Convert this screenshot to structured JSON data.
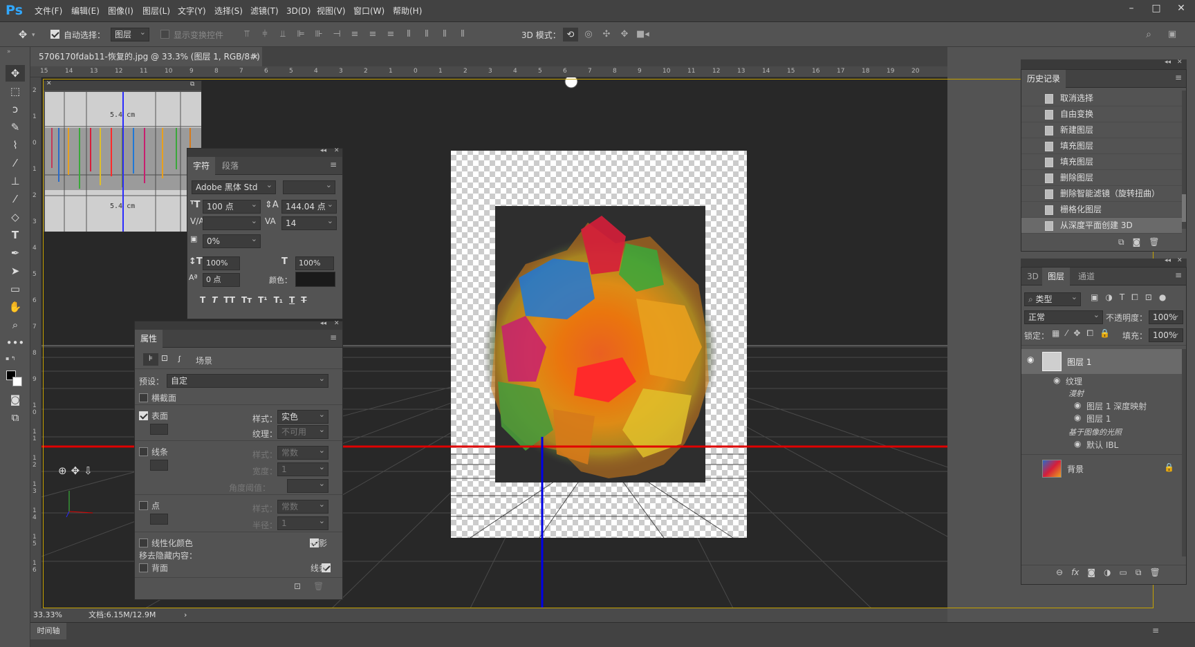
{
  "app": {
    "name": "Ps"
  },
  "menu": [
    "文件(F)",
    "编辑(E)",
    "图像(I)",
    "图层(L)",
    "文字(Y)",
    "选择(S)",
    "滤镜(T)",
    "3D(D)",
    "视图(V)",
    "窗口(W)",
    "帮助(H)"
  ],
  "window_controls": [
    "–",
    "□",
    "✕"
  ],
  "options": {
    "auto_select_label": "自动选择：",
    "auto_select_value": "图层",
    "show_transform_label": "显示变换控件",
    "mode3d_label": "3D 模式："
  },
  "document": {
    "tab_title": "5706170fdab11-恢复的.jpg @ 33.3% (图层 1, RGB/8#) *",
    "close": "×"
  },
  "ruler": {
    "top_ticks": [
      "15",
      "14",
      "13",
      "12",
      "11",
      "10",
      "9",
      "8",
      "7",
      "6",
      "5",
      "4",
      "3",
      "2",
      "1",
      "0",
      "1",
      "2",
      "3",
      "4",
      "5",
      "6",
      "7",
      "8",
      "9",
      "10",
      "11",
      "12",
      "13",
      "14",
      "15",
      "16",
      "17",
      "18",
      "19",
      "20"
    ],
    "left_ticks": [
      "2",
      "1",
      "0",
      "1",
      "2",
      "3",
      "4",
      "5",
      "6",
      "7",
      "8",
      "9",
      "1 0",
      "1 1",
      "1 2",
      "1 3",
      "1 4",
      "1 5",
      "1 6"
    ]
  },
  "texture_preview": {
    "measure1": "5.4  cm",
    "measure2": "5.4  cm"
  },
  "character_panel": {
    "tabs": [
      "字符",
      "段落"
    ],
    "font_family": "Adobe 黑体 Std",
    "font_size": "100 点",
    "leading": "144.04 点",
    "tracking": "14",
    "scale_pct": "0%",
    "vscale": "100%",
    "hscale": "100%",
    "baseline": "0 点",
    "color_label": "颜色："
  },
  "properties_panel": {
    "title": "属性",
    "scene_label": "场景",
    "preset_label": "预设：",
    "preset_value": "自定",
    "cross_section": "横截面",
    "surface": "表面",
    "style_label": "样式：",
    "surface_style": "实色",
    "texture_label": "纹理：",
    "texture_value": "不可用",
    "lines": "线条",
    "lines_style": "常数",
    "width_label": "宽度：",
    "width_value": "1",
    "angle_label": "角度阈值：",
    "points": "点",
    "points_style": "常数",
    "radius_label": "半径：",
    "radius_value": "1",
    "linearize": "线性化颜色",
    "shadow": "阴影",
    "remove_hidden": "移去隐藏内容：",
    "backface": "背面",
    "lines2": "线条"
  },
  "history_panel": {
    "title": "历史记录",
    "items": [
      "取消选择",
      "自由变换",
      "新建图层",
      "填充图层",
      "填充图层",
      "删除图层",
      "删除智能滤镜（旋转扭曲）",
      "栅格化图层",
      "从深度平面创建 3D"
    ]
  },
  "layers_panel": {
    "tabs": [
      "3D",
      "图层",
      "通道"
    ],
    "filter_kind": "类型",
    "blend_mode": "正常",
    "opacity_label": "不透明度：",
    "opacity": "100%",
    "lock_label": "锁定：",
    "fill_label": "填充：",
    "fill": "100%",
    "layers": {
      "layer1": "图层 1",
      "texture": "纹理",
      "diffuse": "漫射",
      "depth_map": "图层 1 深度映射",
      "layer1_sub": "图层 1",
      "ibl": "基于图像的光照",
      "default_ibl": "默认 IBL",
      "background": "背景"
    }
  },
  "status": {
    "zoom": "33.33%",
    "doc": "文档:6.15M/12.9M",
    "arrow": "›"
  },
  "timeline": {
    "label": "时间轴"
  },
  "colors": {
    "accent": "#31a8ff",
    "red_axis": "#e00000",
    "blue_axis": "#0000e6"
  }
}
